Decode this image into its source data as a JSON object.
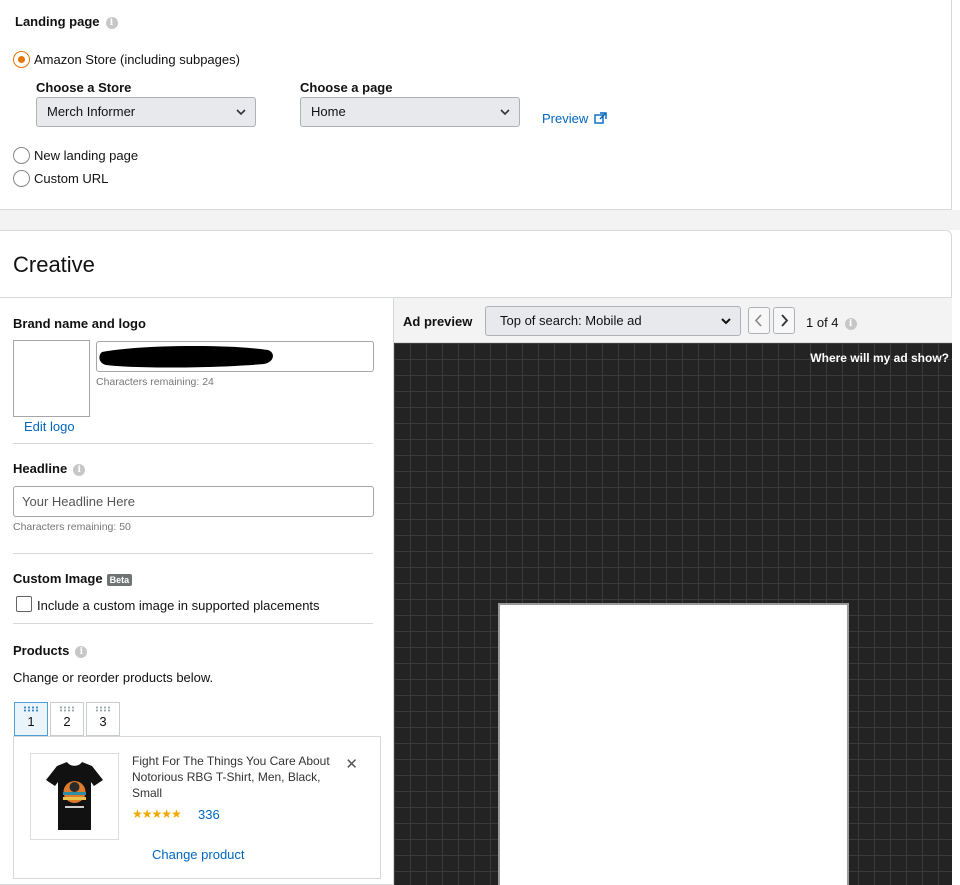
{
  "landing": {
    "title": "Landing page",
    "option_store": "Amazon Store (including subpages)",
    "choose_store_label": "Choose a Store",
    "store_value": "Merch Informer",
    "choose_page_label": "Choose a page",
    "page_value": "Home",
    "preview_link": "Preview",
    "option_new": "New landing page",
    "option_custom": "Custom URL",
    "selected": "store"
  },
  "creative": {
    "title": "Creative",
    "brand": {
      "label": "Brand name and logo",
      "chars_remaining": "Characters remaining: 24",
      "edit_logo": "Edit logo"
    },
    "headline": {
      "label": "Headline",
      "placeholder": "Your Headline Here",
      "chars_remaining": "Characters remaining: 50"
    },
    "custom_image": {
      "label": "Custom Image",
      "badge": "Beta",
      "checkbox_label": "Include a custom image in supported placements",
      "checked": false
    },
    "products": {
      "label": "Products",
      "instructions": "Change or reorder products below.",
      "tabs": [
        "1",
        "2",
        "3"
      ],
      "active_tab": "1",
      "card": {
        "title": "Fight For The Things You Care About Notorious RBG T-Shirt, Men, Black, Small",
        "stars": "★★★★★",
        "rating_count": "336",
        "change_product": "Change product"
      }
    }
  },
  "preview": {
    "label": "Ad preview",
    "placement_value": "Top of search: Mobile ad",
    "pager": "1 of 4",
    "where_show": "Where will my ad show?"
  },
  "colors": {
    "accent_orange": "#e77600",
    "link_blue": "#0066c0",
    "star_gold": "#f0a800",
    "preview_bg": "#232323"
  }
}
